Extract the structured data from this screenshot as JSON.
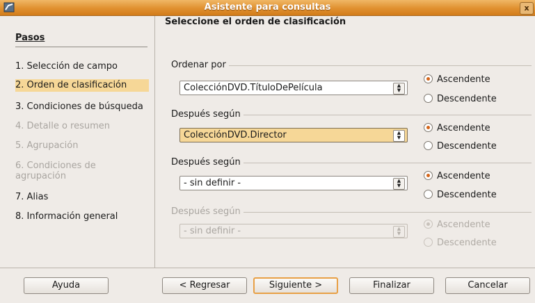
{
  "window": {
    "title": "Asistente para consultas",
    "close_label": "x",
    "icon": "app-icon"
  },
  "sidebar": {
    "title": "Pasos",
    "steps": [
      {
        "label": "1. Selección de campo",
        "state": "normal"
      },
      {
        "label": "2. Orden de clasificación",
        "state": "active"
      },
      {
        "label": "3. Condiciones de búsqueda",
        "state": "normal"
      },
      {
        "label": "4. Detalle o resumen",
        "state": "disabled"
      },
      {
        "label": "5. Agrupación",
        "state": "disabled"
      },
      {
        "label": "6. Condiciones de agrupación",
        "state": "disabled"
      },
      {
        "label": "7. Alias",
        "state": "normal"
      },
      {
        "label": "8. Información general",
        "state": "normal"
      }
    ]
  },
  "main": {
    "title": "Seleccione el orden de clasificación",
    "groups": [
      {
        "label": "Ordenar por",
        "field": "ColecciónDVD.TítuloDePelícula",
        "ascending_label": "Ascendente",
        "descending_label": "Descendente",
        "selected": "ascending",
        "enabled": true,
        "focused": false
      },
      {
        "label": "Después según",
        "field": "ColecciónDVD.Director",
        "ascending_label": "Ascendente",
        "descending_label": "Descendente",
        "selected": "ascending",
        "enabled": true,
        "focused": true
      },
      {
        "label": "Después según",
        "field": "- sin definir -",
        "ascending_label": "Ascendente",
        "descending_label": "Descendente",
        "selected": "ascending",
        "enabled": true,
        "focused": false
      },
      {
        "label": "Después según",
        "field": "- sin definir -",
        "ascending_label": "Ascendente",
        "descending_label": "Descendente",
        "selected": "ascending",
        "enabled": false,
        "focused": false
      }
    ]
  },
  "buttons": {
    "help": "Ayuda",
    "back": "< Regresar",
    "next": "Siguiente >",
    "finish": "Finalizar",
    "cancel": "Cancelar"
  },
  "colors": {
    "accent": "#e0902f",
    "highlight": "#f6d797",
    "radio_selected": "#d4651a"
  }
}
